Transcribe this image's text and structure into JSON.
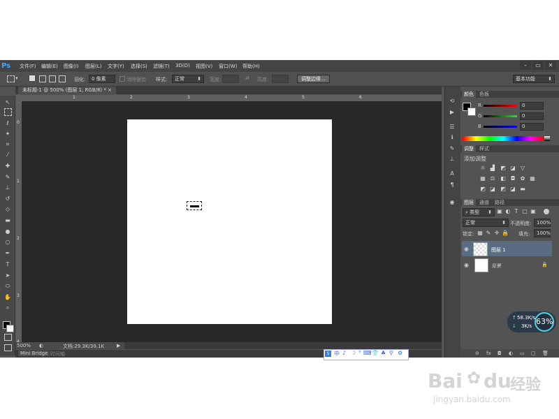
{
  "app": {
    "logo": "Ps",
    "menu": [
      "文件(F)",
      "编辑(E)",
      "图像(I)",
      "图层(L)",
      "文字(Y)",
      "选择(S)",
      "滤镜(T)",
      "3D(D)",
      "视图(V)",
      "窗口(W)",
      "帮助(H)"
    ],
    "window_buttons": [
      "–",
      "▭",
      "✕"
    ]
  },
  "options": {
    "feather_label": "羽化:",
    "feather_value": "0 像素",
    "antialias_label": "消除锯齿",
    "style_label": "样式:",
    "style_value": "正常",
    "width_label": "宽度:",
    "height_label": "高度:",
    "refine_button": "调整边缘...",
    "workspace": "基本功能"
  },
  "document": {
    "tab_title": "未标题-1 @ 500% (图层 1, RGB/8) *",
    "ruler_h": [
      "1",
      "2",
      "3",
      "4",
      "5",
      "6"
    ],
    "ruler_v": [
      "0",
      "1",
      "2",
      "3",
      "4"
    ],
    "zoom": "500%",
    "doc_size": "文档:29.3K/39.1K"
  },
  "bottom_tabs": [
    "Mini Bridge",
    "时间轴"
  ],
  "color_panel": {
    "tabs": [
      "颜色",
      "色板"
    ],
    "channels": [
      {
        "label": "R",
        "value": "0"
      },
      {
        "label": "G",
        "value": "0"
      },
      {
        "label": "B",
        "value": "0"
      }
    ]
  },
  "adjust_panel": {
    "tabs": [
      "调整",
      "样式"
    ],
    "title": "添加调整"
  },
  "layers_panel": {
    "tabs": [
      "图层",
      "通道",
      "路径"
    ],
    "filter": "类型",
    "blend_mode": "正常",
    "opacity_label": "不透明度:",
    "opacity_value": "100%",
    "lock_label": "锁定:",
    "fill_label": "填充:",
    "fill_value": "100%",
    "layers": [
      {
        "name": "图层 1",
        "selected": true
      },
      {
        "name": "背景",
        "selected": false
      }
    ]
  },
  "net_widget": {
    "upload": "58.3",
    "upload_unit": "K/s",
    "download": "3",
    "download_unit": "K/s",
    "percent": "63%"
  },
  "ime": {
    "items": [
      "中",
      "♪",
      "☽",
      "°",
      "⌨",
      "👕",
      "♣",
      "⚲",
      "⚙"
    ]
  },
  "watermark": {
    "brand": "Bai",
    "brand2": "du",
    "cn": "经验",
    "url": "jingyan.baidu.com"
  },
  "colors": {
    "accent": "#4fa3f7",
    "selected_layer": "#5a6b84",
    "canvas_bg": "#282828"
  }
}
